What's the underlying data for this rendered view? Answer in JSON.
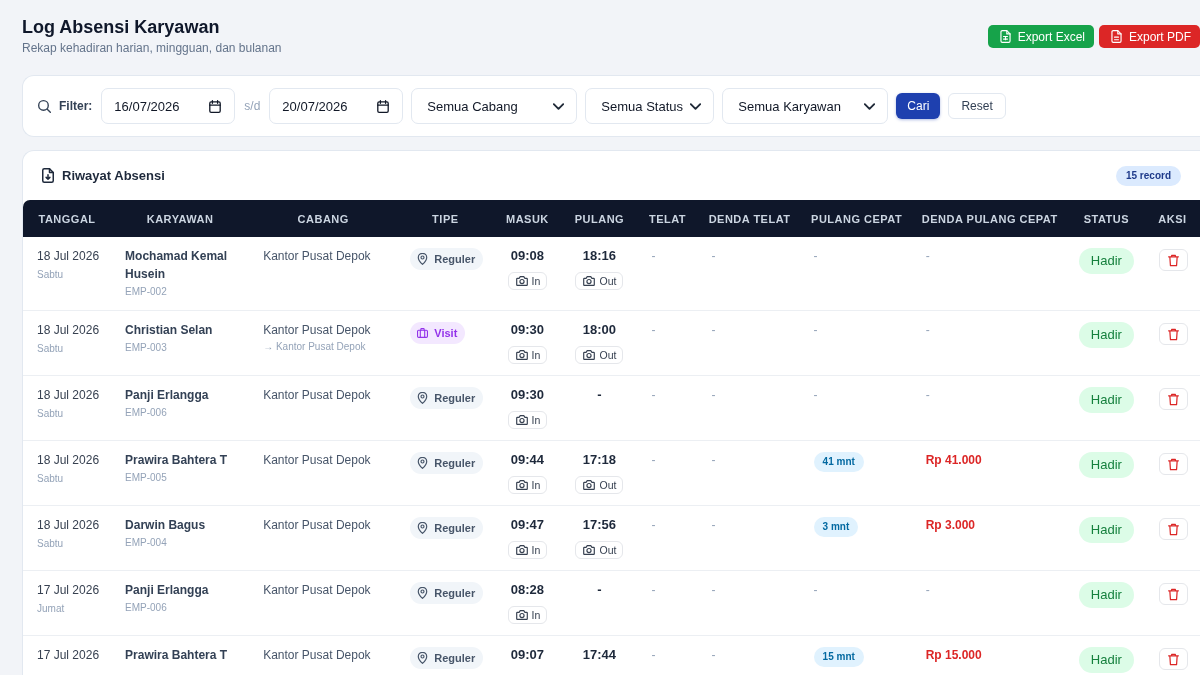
{
  "page": {
    "title": "Log Absensi Karyawan",
    "subtitle": "Rekap kehadiran harian, mingguan, dan bulanan"
  },
  "actions": [
    {
      "kind": "excel",
      "label": "Export Excel"
    },
    {
      "kind": "pdf",
      "label": "Export PDF"
    }
  ],
  "filter": {
    "label": "Filter:",
    "date_from": "16/07/2026",
    "separator": "s/d",
    "date_to": "20/07/2026",
    "selects": [
      "Semua Cabang",
      "Semua Status",
      "Semua Karyawan"
    ],
    "buttons": [
      {
        "kind": "search",
        "label": "Cari"
      },
      {
        "kind": "reset",
        "label": "Reset"
      }
    ]
  },
  "table": {
    "title": "Riwayat Absensi",
    "count": "15 record",
    "columns": [
      "TANGGAL",
      "KARYAWAN",
      "CABANG",
      "TIPE",
      "MASUK",
      "PULANG",
      "TELAT",
      "DENDA TELAT",
      "PULANG CEPAT",
      "DENDA PULANG CEPAT",
      "STATUS",
      "AKSI"
    ],
    "rows": [
      {
        "date": "18 Jul 2026",
        "day": "Sabtu",
        "name": "Mochamad Kemal Husein",
        "employee_id": "EMP-002",
        "branch": "Kantor Pusat Depok",
        "type": {
          "kind": "regular",
          "label": "Reguler"
        },
        "check_in": {
          "time": "09:08",
          "photo": "In"
        },
        "check_out": {
          "time": "18:16",
          "photo": "Out"
        },
        "late": "-",
        "late_fine": "-",
        "early_leave": {
          "kind": "none",
          "text": "-"
        },
        "early_leave_fine": {
          "kind": "none",
          "text": "-"
        },
        "status": "Hadir"
      },
      {
        "date": "18 Jul 2026",
        "day": "Sabtu",
        "name": "Christian Selan",
        "employee_id": "EMP-003",
        "branch": "Kantor Pusat Depok",
        "destination": "→ Kantor Pusat Depok",
        "type": {
          "kind": "visit",
          "label": "Visit"
        },
        "check_in": {
          "time": "09:30",
          "photo": "In"
        },
        "check_out": {
          "time": "18:00",
          "photo": "Out"
        },
        "late": "-",
        "late_fine": "-",
        "early_leave": {
          "kind": "none",
          "text": "-"
        },
        "early_leave_fine": {
          "kind": "none",
          "text": "-"
        },
        "status": "Hadir"
      },
      {
        "date": "18 Jul 2026",
        "day": "Sabtu",
        "name": "Panji Erlangga",
        "employee_id": "EMP-006",
        "branch": "Kantor Pusat Depok",
        "type": {
          "kind": "regular",
          "label": "Reguler"
        },
        "check_in": {
          "time": "09:30",
          "photo": "In"
        },
        "check_out": {
          "time": "-"
        },
        "late": "-",
        "late_fine": "-",
        "early_leave": {
          "kind": "none",
          "text": "-"
        },
        "early_leave_fine": {
          "kind": "none",
          "text": "-"
        },
        "status": "Hadir"
      },
      {
        "date": "18 Jul 2026",
        "day": "Sabtu",
        "name": "Prawira Bahtera T",
        "employee_id": "EMP-005",
        "branch": "Kantor Pusat Depok",
        "type": {
          "kind": "regular",
          "label": "Reguler"
        },
        "check_in": {
          "time": "09:44",
          "photo": "In"
        },
        "check_out": {
          "time": "17:18",
          "photo": "Out"
        },
        "late": "-",
        "late_fine": "-",
        "early_leave": {
          "kind": "badge",
          "text": "41 mnt"
        },
        "early_leave_fine": {
          "kind": "amount",
          "text": "Rp 41.000"
        },
        "status": "Hadir"
      },
      {
        "date": "18 Jul 2026",
        "day": "Sabtu",
        "name": "Darwin Bagus",
        "employee_id": "EMP-004",
        "branch": "Kantor Pusat Depok",
        "type": {
          "kind": "regular",
          "label": "Reguler"
        },
        "check_in": {
          "time": "09:47",
          "photo": "In"
        },
        "check_out": {
          "time": "17:56",
          "photo": "Out"
        },
        "late": "-",
        "late_fine": "-",
        "early_leave": {
          "kind": "badge",
          "text": "3 mnt"
        },
        "early_leave_fine": {
          "kind": "amount",
          "text": "Rp 3.000"
        },
        "status": "Hadir"
      },
      {
        "date": "17 Jul 2026",
        "day": "Jumat",
        "name": "Panji Erlangga",
        "employee_id": "EMP-006",
        "branch": "Kantor Pusat Depok",
        "type": {
          "kind": "regular",
          "label": "Reguler"
        },
        "check_in": {
          "time": "08:28",
          "photo": "In"
        },
        "check_out": {
          "time": "-"
        },
        "late": "-",
        "late_fine": "-",
        "early_leave": {
          "kind": "none",
          "text": "-"
        },
        "early_leave_fine": {
          "kind": "none",
          "text": "-"
        },
        "status": "Hadir"
      },
      {
        "date": "17 Jul 2026",
        "name": "Prawira Bahtera T",
        "branch": "Kantor Pusat Depok",
        "type": {
          "kind": "regular",
          "label": "Reguler"
        },
        "check_in": {
          "time": "09:07"
        },
        "check_out": {
          "time": "17:44"
        },
        "late": "-",
        "late_fine": "-",
        "early_leave": {
          "kind": "badge",
          "text": "15 mnt"
        },
        "early_leave_fine": {
          "kind": "amount",
          "text": "Rp 15.000"
        },
        "status": "Hadir"
      }
    ]
  }
}
